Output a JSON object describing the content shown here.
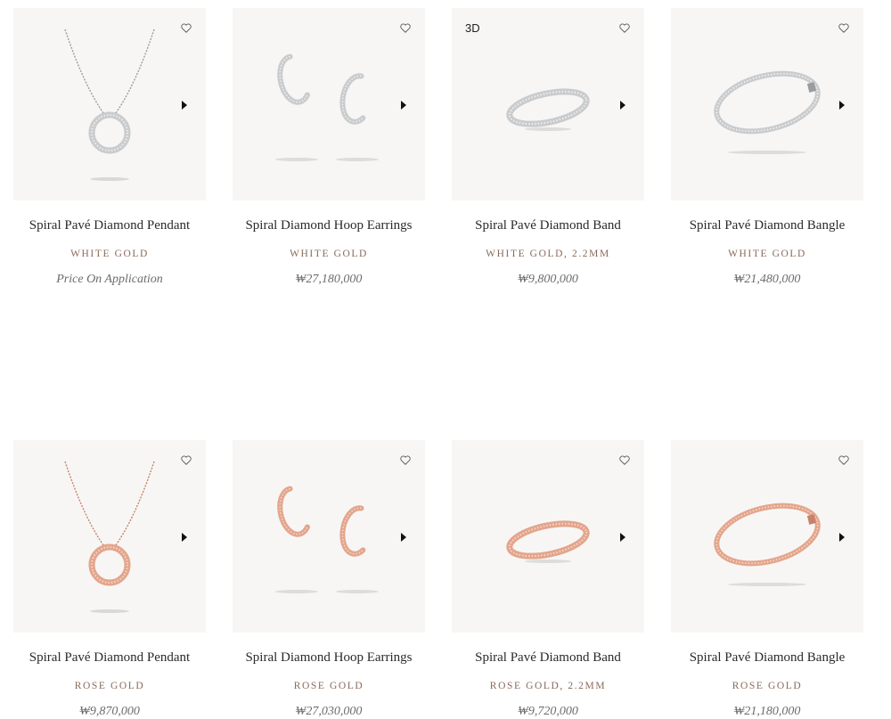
{
  "icons": {
    "wishlist": "heart-outline-icon",
    "next": "play-arrow-icon"
  },
  "colors": {
    "white_gold": "#c9cbcd",
    "rose_gold": "#e3a58c",
    "card_bg": "#f7f6f5",
    "metal_text": "#8a6a5a"
  },
  "products": [
    {
      "name": "Spiral Pavé Diamond Pendant",
      "metal": "WHITE GOLD",
      "price": "Price On Application",
      "badge": "",
      "type": "pendant",
      "tone": "white"
    },
    {
      "name": "Spiral Diamond Hoop Earrings",
      "metal": "WHITE GOLD",
      "price": "₩27,180,000",
      "badge": "",
      "type": "earrings",
      "tone": "white"
    },
    {
      "name": "Spiral Pavé Diamond Band",
      "metal": "WHITE GOLD, 2.2MM",
      "price": "₩9,800,000",
      "badge": "3D",
      "type": "band",
      "tone": "white"
    },
    {
      "name": "Spiral Pavé Diamond Bangle",
      "metal": "WHITE GOLD",
      "price": "₩21,480,000",
      "badge": "",
      "type": "bangle",
      "tone": "white"
    },
    {
      "name": "Spiral Pavé Diamond Pendant",
      "metal": "ROSE GOLD",
      "price": "₩9,870,000",
      "badge": "",
      "type": "pendant",
      "tone": "rose"
    },
    {
      "name": "Spiral Diamond Hoop Earrings",
      "metal": "ROSE GOLD",
      "price": "₩27,030,000",
      "badge": "",
      "type": "earrings",
      "tone": "rose"
    },
    {
      "name": "Spiral Pavé Diamond Band",
      "metal": "ROSE GOLD, 2.2MM",
      "price": "₩9,720,000",
      "badge": "",
      "type": "band",
      "tone": "rose"
    },
    {
      "name": "Spiral Pavé Diamond Bangle",
      "metal": "ROSE GOLD",
      "price": "₩21,180,000",
      "badge": "",
      "type": "bangle",
      "tone": "rose"
    }
  ]
}
